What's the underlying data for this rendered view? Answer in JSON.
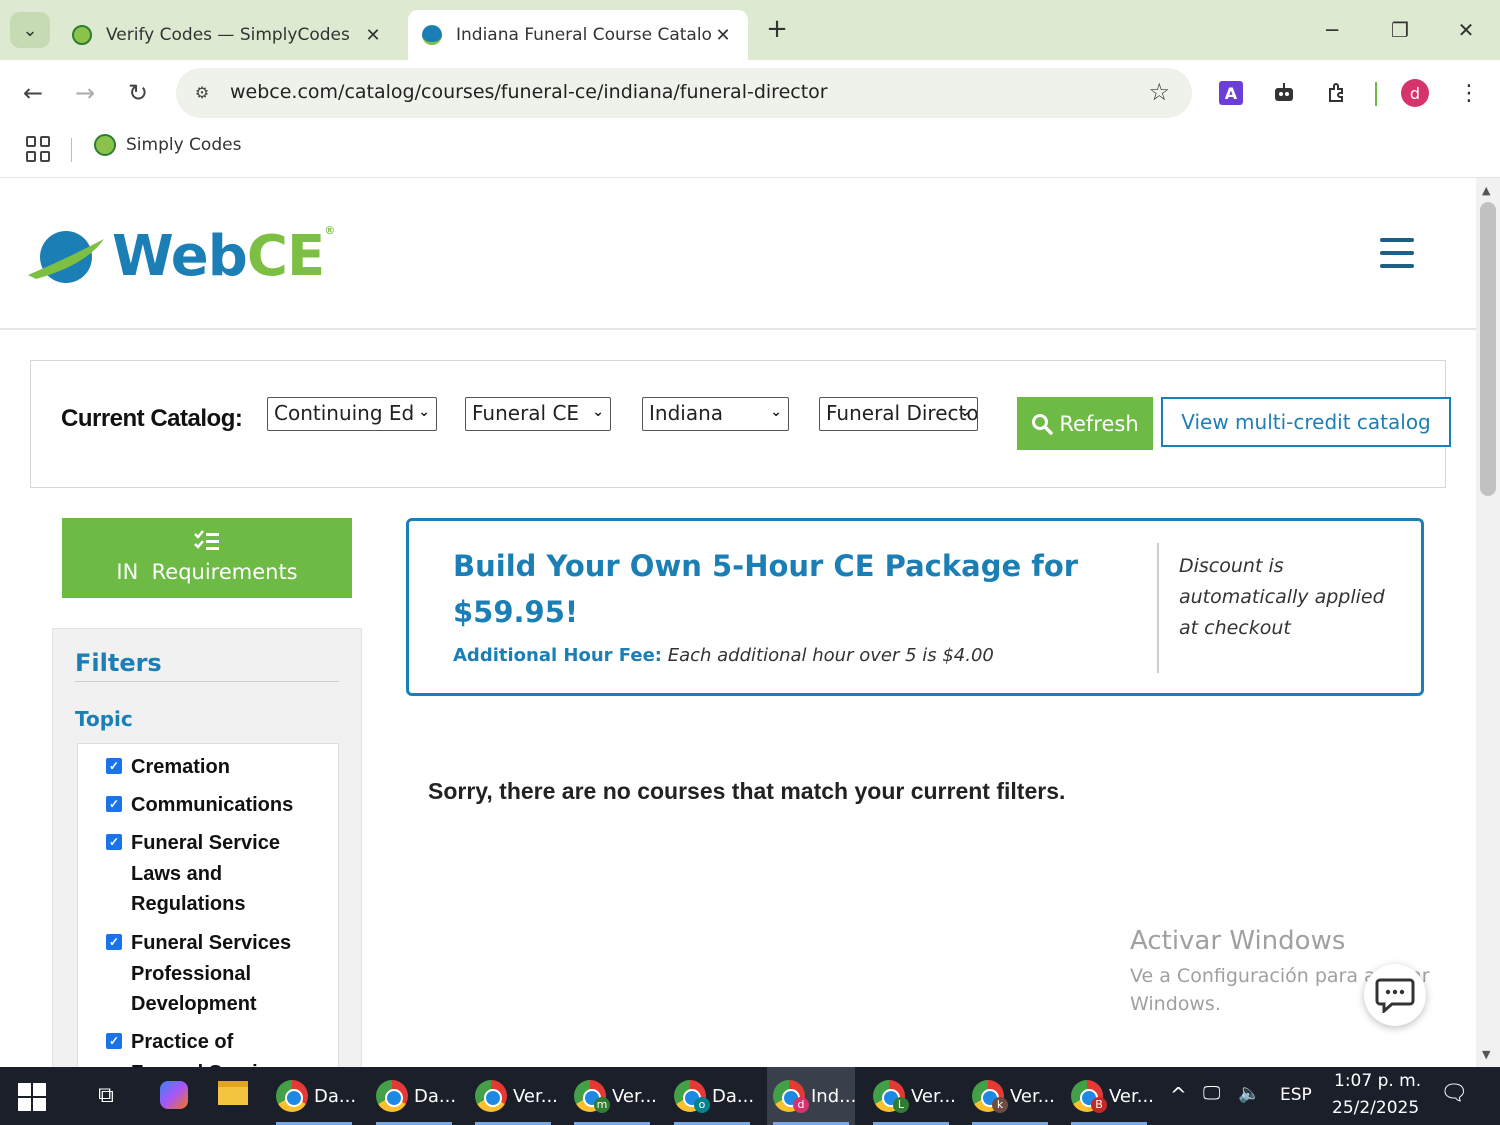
{
  "browser": {
    "tabs": [
      {
        "title": "Verify Codes — SimplyCodes",
        "active": false
      },
      {
        "title": "Indiana Funeral Course Catalog",
        "active": true
      }
    ],
    "url": "webce.com/catalog/courses/funeral-ce/indiana/funeral-director",
    "bookmarks": [
      {
        "label": "Simply Codes"
      }
    ],
    "profile_initial": "d",
    "extension_letter": "A"
  },
  "site": {
    "logo_web": "Web",
    "logo_ce": "CE",
    "logo_reg": "®"
  },
  "catalog": {
    "label": "Current Catalog:",
    "selects": [
      {
        "value": "Continuing Ed"
      },
      {
        "value": "Funeral CE"
      },
      {
        "value": "Indiana"
      },
      {
        "value": "Funeral Director"
      }
    ],
    "refresh_label": "Refresh",
    "multi_credit_label": "View multi-credit catalog"
  },
  "sidebar": {
    "requirements_label": "IN  Requirements",
    "filters_title": "Filters",
    "topic_title": "Topic",
    "topics": [
      {
        "label": "Cremation",
        "checked": true
      },
      {
        "label": "Communications",
        "checked": true
      },
      {
        "label": "Funeral Service Laws and Regulations",
        "checked": true
      },
      {
        "label": "Funeral Services Professional Development",
        "checked": true
      },
      {
        "label": "Practice of Funeral Service",
        "checked": true
      }
    ]
  },
  "promo": {
    "title": "Build Your Own 5-Hour CE Package for $59.95!",
    "fee_label": "Additional Hour Fee:",
    "fee_text": "Each additional hour over 5 is $4.00",
    "note": "Discount is automatically applied at checkout"
  },
  "main": {
    "no_results": "Sorry, there are no courses that match your current filters."
  },
  "watermark": {
    "line1": "Activar Windows",
    "line2": "Ve a Configuración para activar Windows."
  },
  "taskbar": {
    "apps": [
      {
        "label": "Da...",
        "badge": "",
        "badge_color": ""
      },
      {
        "label": "Da...",
        "badge": "",
        "badge_color": ""
      },
      {
        "label": "Ver...",
        "badge": "",
        "badge_color": ""
      },
      {
        "label": "Ver...",
        "badge": "m",
        "badge_color": "#2e7d32"
      },
      {
        "label": "Da...",
        "badge": "o",
        "badge_color": "#00838f"
      },
      {
        "label": "Ind...",
        "badge": "d",
        "badge_color": "#d6336c"
      },
      {
        "label": "Ver...",
        "badge": "L",
        "badge_color": "#2e7d32"
      },
      {
        "label": "Ver...",
        "badge": "k",
        "badge_color": "#6d4c41"
      },
      {
        "label": "Ver...",
        "badge": "B",
        "badge_color": "#c62828"
      }
    ],
    "language": "ESP",
    "time": "1:07 p. m.",
    "date": "25/2/2025"
  },
  "colors": {
    "brand_blue": "#1b7fb5",
    "brand_green": "#6dbb45",
    "tab_strip": "#dde9d0"
  }
}
